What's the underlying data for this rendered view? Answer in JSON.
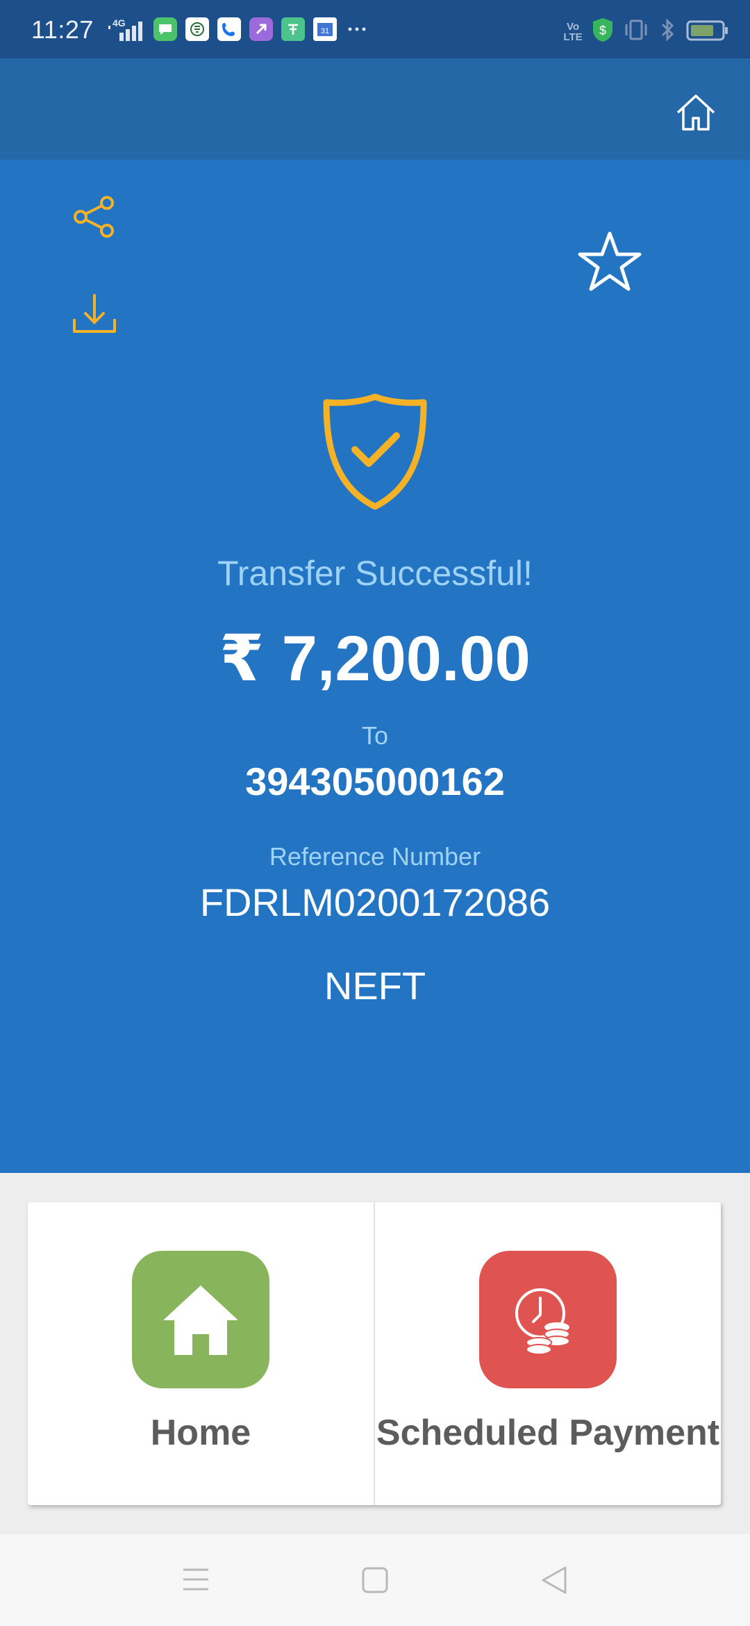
{
  "status_bar": {
    "time": "11:27",
    "network": "4G",
    "volte": "Vo LTE",
    "icons": [
      "signal-icon",
      "messages-icon",
      "app-icon",
      "phone-icon",
      "shortcut-icon",
      "app-icon-2",
      "calendar-icon",
      "more-dots-icon",
      "security-icon",
      "vibrate-icon",
      "bluetooth-icon",
      "battery-icon"
    ]
  },
  "toolbar": {
    "home_icon": "home-outline-icon",
    "share_icon": "share-icon",
    "download_icon": "download-icon",
    "favorite_icon": "star-outline-icon"
  },
  "receipt": {
    "status_icon": "shield-check-icon",
    "status_text": "Transfer Successful!",
    "amount": "₹ 7,200.00",
    "to_label": "To",
    "to_account": "394305000162",
    "reference_label": "Reference Number",
    "reference_number": "FDRLM0200172086",
    "transfer_type": "NEFT"
  },
  "actions": [
    {
      "label": "Home",
      "icon": "house-icon",
      "color": "#88b55c"
    },
    {
      "label": "Scheduled Payment",
      "icon": "clock-coins-icon",
      "color": "#df5450"
    }
  ],
  "colors": {
    "status_bar": "#1d4f8b",
    "app_bar": "#2568a8",
    "main_bg": "#2374c3",
    "accent_yellow": "#f5b227",
    "success_text": "#9fd3f5"
  },
  "nav_bar": [
    "menu-icon",
    "home-square-icon",
    "back-triangle-icon"
  ]
}
